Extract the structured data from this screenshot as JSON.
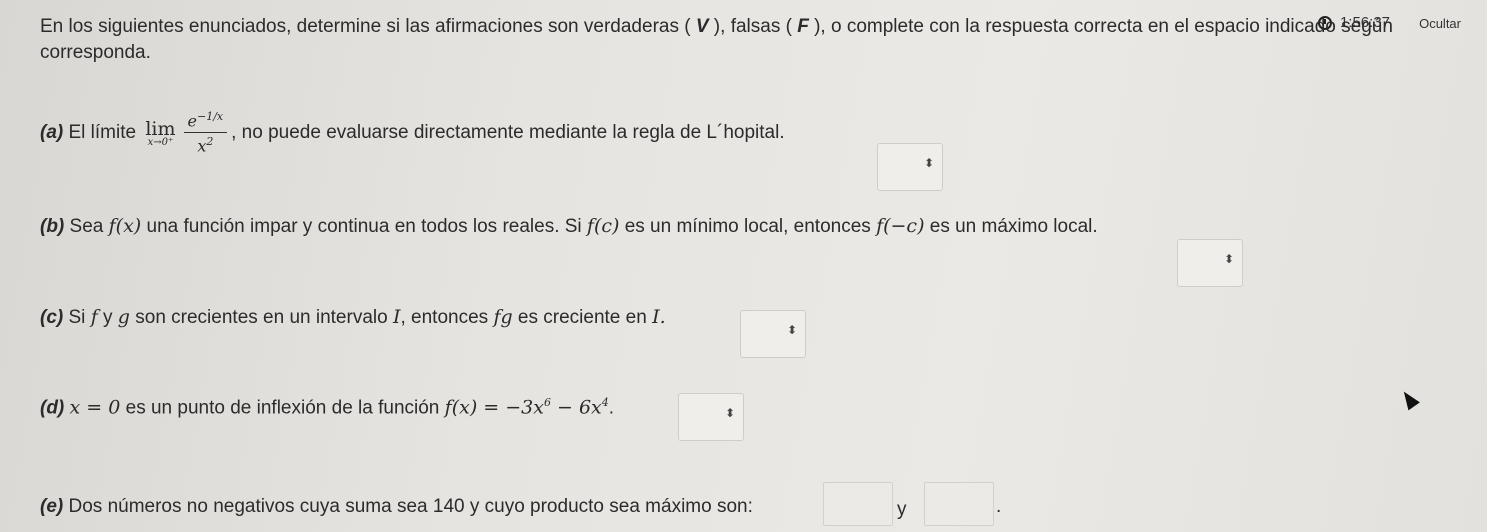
{
  "timer": {
    "value": "1:56:37"
  },
  "hide_button": {
    "label": "Ocultar"
  },
  "intro": {
    "part1": "En los siguientes enunciados, determine si las afirmaciones son verdaderas ( ",
    "v": "V",
    "part2": " ), falsas ( ",
    "f": "F",
    "part3": " ), o complete con la respuesta correcta en el espacio indicado según",
    "part4": "corresponda."
  },
  "items": {
    "a": {
      "label": "(a)",
      "pre": " El límite ",
      "lim": "lim",
      "lim_sub": "x→0⁺",
      "num": "e",
      "num_sup": "−1/x",
      "den": "x",
      "den_sup": "2",
      "post": ", no puede evaluarse directamente mediante la regla de L´hopital."
    },
    "b": {
      "label": "(b)",
      "t1": " Sea ",
      "m1": "f(x)",
      "t2": " una función impar y continua en todos los reales. Si ",
      "m2": "f(c)",
      "t3": " es un mínimo local, entonces ",
      "m3": "f(−c)",
      "t4": " es un máximo local."
    },
    "c": {
      "label": "(c)",
      "t1": " Si ",
      "m1": "f",
      "t2": " y ",
      "m2": "g",
      "t3": " son crecientes en un intervalo ",
      "m3": "I",
      "t4": ", entonces ",
      "m4": "fg",
      "t5": " es creciente en ",
      "m5": "I."
    },
    "d": {
      "label": "(d)",
      "m1": "x = 0",
      "t1": " es un punto de inflexión de la función ",
      "m2": "f(x) = −3x",
      "sup1": "6",
      "m3": " − 6x",
      "sup2": "4",
      "t2": "."
    },
    "e": {
      "label": "(e)",
      "t1": " Dos números no negativos cuya suma sea 140 y cuyo producto sea máximo son:",
      "conj": "y",
      "end": "."
    }
  },
  "select_arrow": "⬍"
}
